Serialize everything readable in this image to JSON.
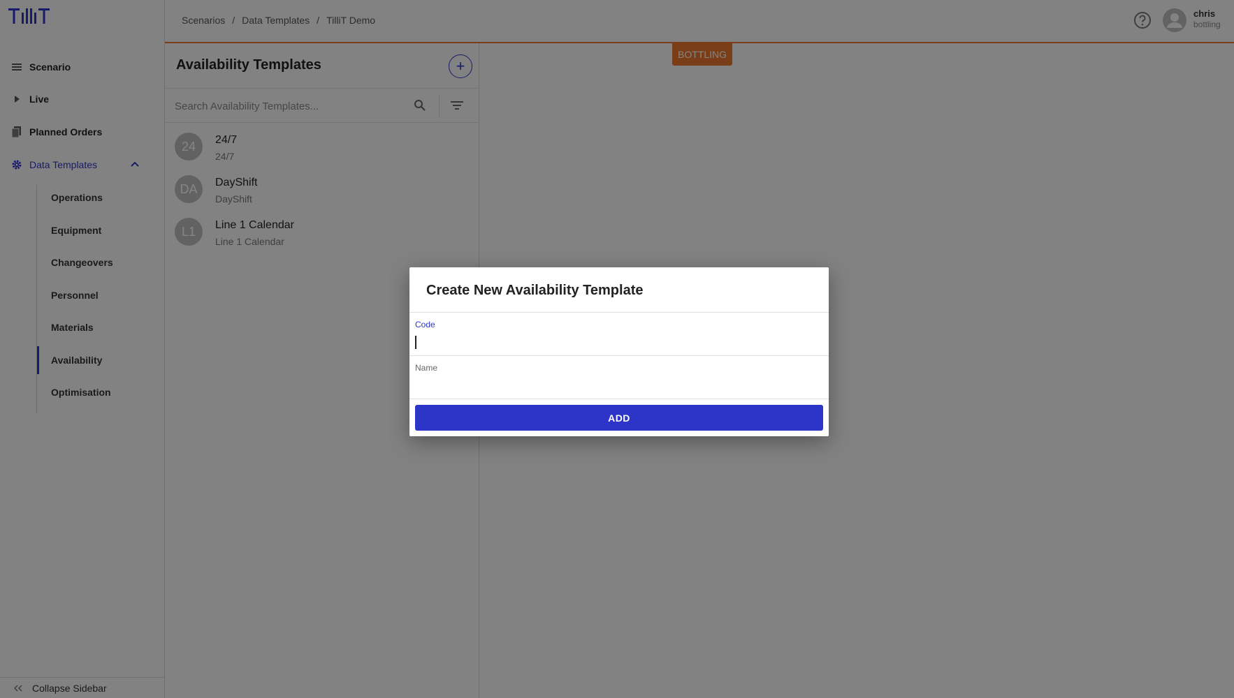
{
  "brand": {
    "logo_text": "TilliT",
    "accent": "#2d35c9",
    "orange": "#e8772e"
  },
  "sidebar": {
    "items": [
      {
        "label": "Scenario",
        "icon": "list-icon"
      },
      {
        "label": "Live",
        "icon": "play-icon"
      },
      {
        "label": "Planned Orders",
        "icon": "document-icon"
      },
      {
        "label": "Data Templates",
        "icon": "gear-icon"
      }
    ],
    "sub_items": [
      {
        "label": "Operations"
      },
      {
        "label": "Equipment"
      },
      {
        "label": "Changeovers"
      },
      {
        "label": "Personnel"
      },
      {
        "label": "Materials"
      },
      {
        "label": "Availability"
      },
      {
        "label": "Optimisation"
      }
    ],
    "collapse_label": "Collapse Sidebar"
  },
  "topbar": {
    "breadcrumb": [
      "Scenarios",
      "Data Templates",
      "TilliT Demo"
    ],
    "separator": "/",
    "user": {
      "name": "chris",
      "sub": "bottling"
    }
  },
  "list": {
    "title": "Availability Templates",
    "search_placeholder": "Search Availability Templates...",
    "rows": [
      {
        "badge": "24",
        "title": "24/7",
        "sub": "24/7"
      },
      {
        "badge": "DA",
        "title": "DayShift",
        "sub": "DayShift"
      },
      {
        "badge": "L1",
        "title": "Line 1 Calendar",
        "sub": "Line 1 Calendar"
      }
    ]
  },
  "main": {
    "tag": "BOTTLING"
  },
  "dialog": {
    "title": "Create New Availability Template",
    "code_label": "Code",
    "code_value": "",
    "name_label": "Name",
    "name_value": "",
    "add_label": "ADD"
  }
}
